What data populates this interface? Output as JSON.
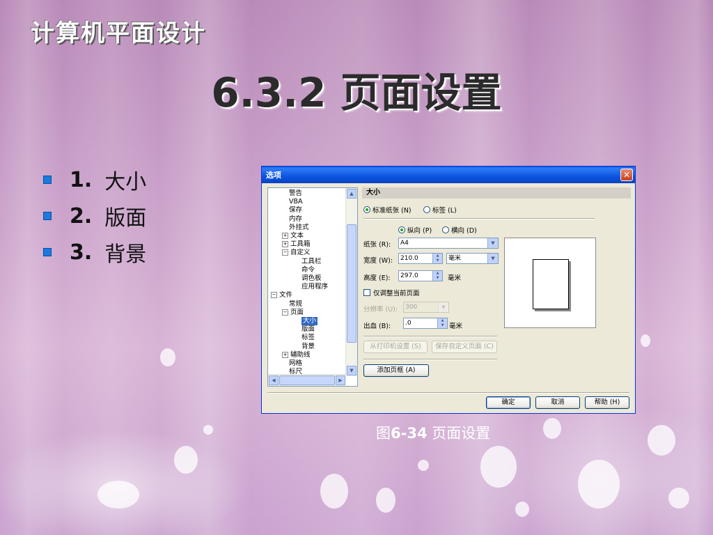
{
  "slide": {
    "brand": "计算机平面设计",
    "title": "6.3.2 页面设置",
    "bullets": [
      {
        "num": "1.",
        "text": "大小"
      },
      {
        "num": "2.",
        "text": "版面"
      },
      {
        "num": "3.",
        "text": "背景"
      }
    ],
    "caption_prefix": "图",
    "caption_num": "6-34",
    "caption_text": " 页面设置"
  },
  "dialog": {
    "title": "选项",
    "close_glyph": "✕",
    "tree": [
      {
        "label": "警告"
      },
      {
        "label": "VBA"
      },
      {
        "label": "保存"
      },
      {
        "label": "内存"
      },
      {
        "label": "外挂式"
      },
      {
        "label": "文本",
        "expander": "+"
      },
      {
        "label": "工具箱",
        "expander": "+"
      },
      {
        "label": "自定义",
        "expander": "−"
      },
      {
        "label": "工具栏"
      },
      {
        "label": "命令"
      },
      {
        "label": "调色板"
      },
      {
        "label": "应用程序"
      },
      {
        "label": "文件",
        "expander": "−"
      },
      {
        "label": "常规"
      },
      {
        "label": "页面",
        "expander": "−"
      },
      {
        "label": "大小",
        "selected": true
      },
      {
        "label": "版面"
      },
      {
        "label": "标签"
      },
      {
        "label": "背景"
      },
      {
        "label": "辅助线",
        "expander": "+"
      },
      {
        "label": "网格"
      },
      {
        "label": "标尺"
      }
    ],
    "section_title": "大小",
    "radio_standard": "标准纸张 (N)",
    "radio_label": "标签 (L)",
    "radio_portrait": "纵向 (P)",
    "radio_landscape": "横向 (D)",
    "paper_label": "纸张 (R):",
    "paper_value": "A4",
    "width_label": "宽度 (W):",
    "width_value": "210.0",
    "width_unit": "毫米",
    "height_label": "高度 (E):",
    "height_value": "297.0",
    "height_unit": "毫米",
    "current_page_only": "仅调整当前页面",
    "resolution_label": "分辨率 (U):",
    "resolution_value": "300",
    "bleed_label": "出血 (B):",
    "bleed_value": ".0",
    "bleed_unit": "毫米",
    "from_printer_btn": "从打印机设置 (S)",
    "save_custom_btn": "保存自定义页面 (C)",
    "add_frame_btn": "添加页框 (A)",
    "ok_btn": "确定",
    "cancel_btn": "取消",
    "help_btn": "帮助 (H)"
  }
}
